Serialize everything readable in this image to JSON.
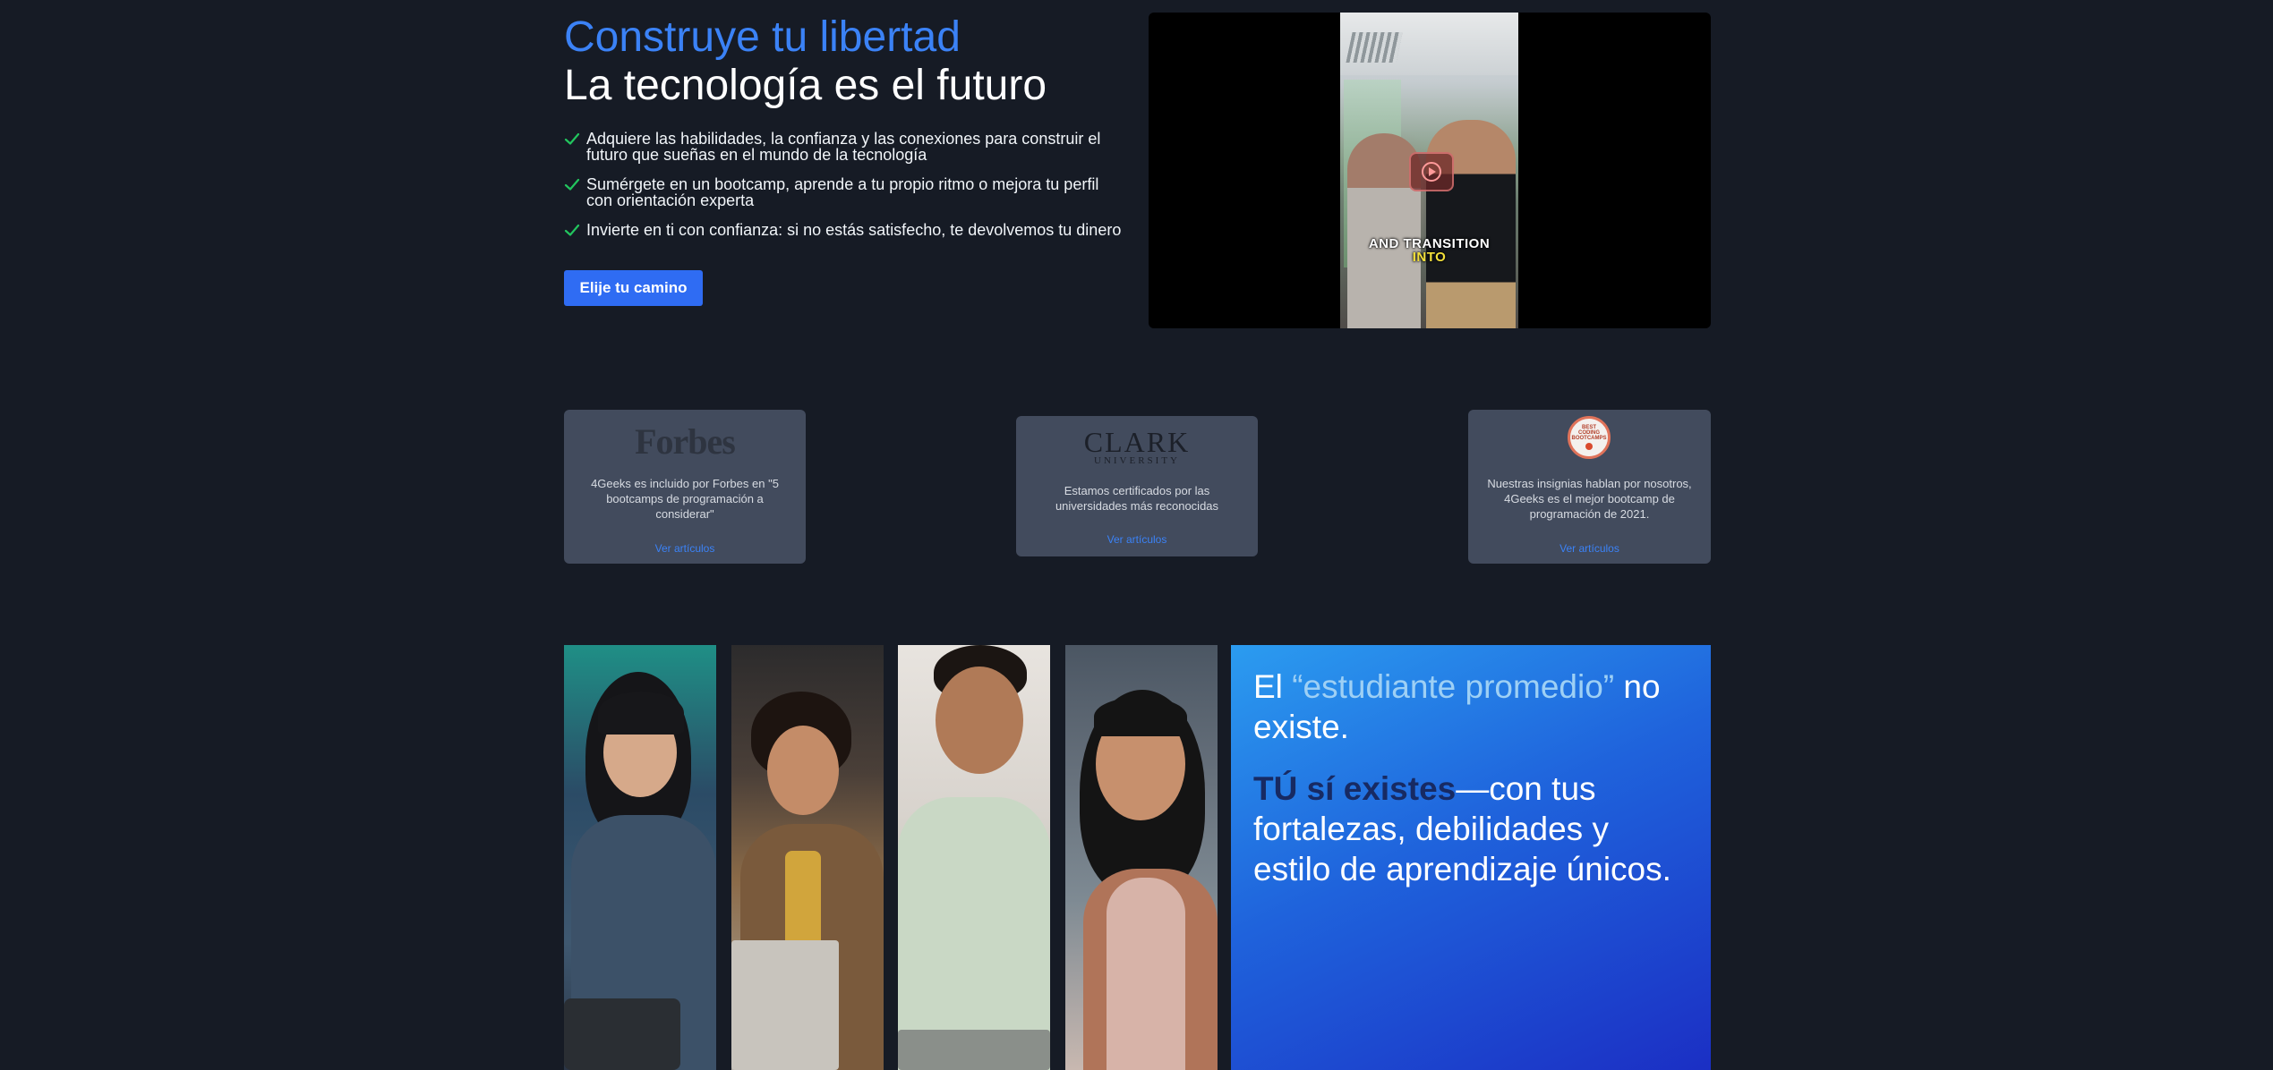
{
  "hero": {
    "title_accent": "Construye tu libertad",
    "title_main": "La tecnología es el futuro",
    "bullets": [
      "Adquiere las habilidades, la confianza y las conexiones para construir el futuro que sueñas en el mundo de la tecnología",
      "Sumérgete en un bootcamp, aprende a tu propio ritmo o mejora tu perfil con orientación experta",
      "Invierte en ti con confianza: si no estás satisfecho, te devolvemos tu dinero"
    ],
    "cta_label": "Elije tu camino",
    "check_icon": "check-icon",
    "accent_color": "#3b82f6",
    "check_color": "#22c55e"
  },
  "video": {
    "caption_line1": "AND TRANSITION",
    "caption_line2": "INTO",
    "play_icon": "play-icon"
  },
  "recognitions": [
    {
      "logo": "Forbes",
      "description": "4Geeks es incluido por Forbes en \"5 bootcamps de programación a considerar\"",
      "link": "Ver artículos"
    },
    {
      "logo_line1": "CLARK",
      "logo_line2": "UNIVERSITY",
      "description": "Estamos certificados por las universidades más reconocidas",
      "link": "Ver artículos"
    },
    {
      "logo_line1": "BEST",
      "logo_line2": "CODING",
      "logo_line3": "BOOTCAMPS",
      "description": "Nuestras insignias hablan por nosotros, 4Geeks es el mejor bootcamp de programación de 2021.",
      "link": "Ver artículos"
    }
  ],
  "promo": {
    "part1_prefix": "El ",
    "part1_highlight": "“estudiante promedio”",
    "part1_suffix": " no existe.",
    "part2_highlight": "TÚ sí existes",
    "part2_suffix": "—con tus fortalezas, debilidades y estilo de aprendizaje únicos."
  }
}
